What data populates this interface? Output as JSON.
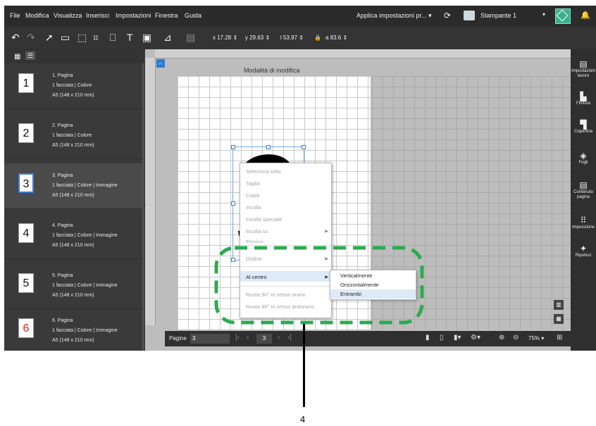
{
  "menubar": {
    "items": [
      "File",
      "Modifica",
      "Visualizza",
      "Inserisci",
      "Impostazioni",
      "Finestra",
      "Guida"
    ],
    "apply_settings": "Applica impostazioni pr...",
    "printer_name": "Stampante 1"
  },
  "toolbar": {
    "x_label": "x",
    "x_value": "17.28",
    "y_label": "y",
    "y_value": "29.63",
    "w_label": "l",
    "w_value": "53.97",
    "h_label": "a",
    "h_value": "83.6"
  },
  "pages": [
    {
      "number": "1",
      "title": "1. Pagina",
      "line1": "1 facciata | Colore",
      "line2": "A5 (148 x 210 mm)"
    },
    {
      "number": "2",
      "title": "2. Pagina",
      "line1": "1 facciata | Colore",
      "line2": "A5 (148 x 210 mm)"
    },
    {
      "number": "3",
      "title": "3. Pagina",
      "line1": "1 facciata | Colore | Immagine",
      "line2": "A5 (148 x 210 mm)"
    },
    {
      "number": "4",
      "title": "4. Pagina",
      "line1": "1 facciata | Colore | Immagine",
      "line2": "A5 (148 x 210 mm)"
    },
    {
      "number": "5",
      "title": "5. Pagina",
      "line1": "1 facciata | Colore | Immagine",
      "line2": "A5 (148 x 210 mm)"
    },
    {
      "number": "6",
      "title": "6. Pagina",
      "line1": "1 facciata | Colore | Immagine",
      "line2": "A5 (148 x 210 mm)"
    }
  ],
  "selected_page": "3",
  "canvas": {
    "mode_label": "Modalità di modifica",
    "big_digit": "3"
  },
  "context_menu": {
    "items": [
      "Seleziona tutto",
      "Taglia",
      "Copia",
      "Incolla",
      "Incolla speciale",
      "Incolla su",
      "Elimina",
      "Ordine",
      "Al centro",
      "Ruota 90° in senso orario",
      "Ruota 90° in senso antiorario"
    ],
    "submenu": [
      "Verticalmente",
      "Orizzontalmente",
      "Entrambi"
    ]
  },
  "nav_bar": {
    "pages_label": "Pagine",
    "pages_count": "3",
    "current_page": "3",
    "zoom": "75%"
  },
  "right_panel": [
    "Impostazioni lavoro",
    "Finitura",
    "Copertina",
    "Fogli",
    "Contenuto pagina",
    "Imposizione",
    "Ripulisci"
  ],
  "callout": "4",
  "colors": {
    "accent": "#3bb08f",
    "highlight": "#2bab4f",
    "selection": "#3b7de0"
  }
}
